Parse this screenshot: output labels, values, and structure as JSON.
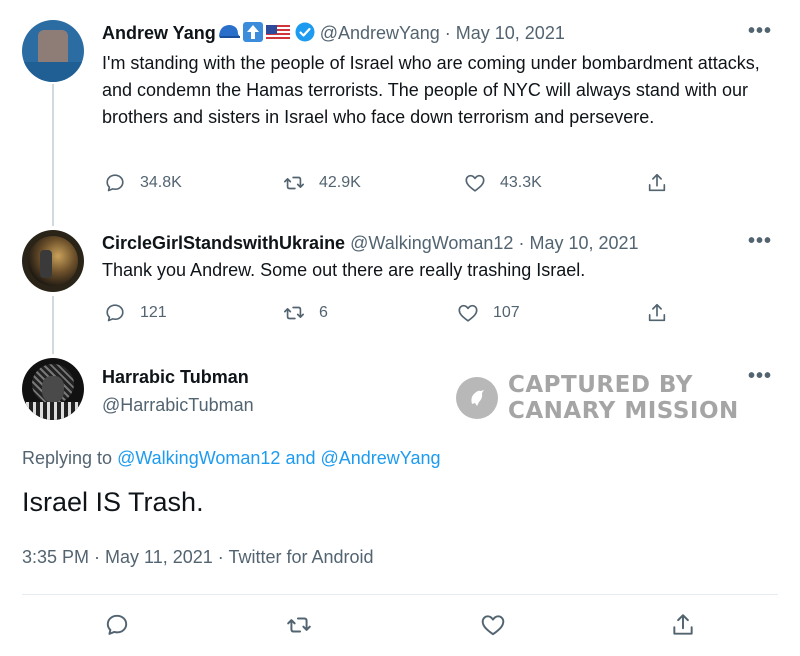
{
  "thread": {
    "tweets": [
      {
        "name": "Andrew Yang",
        "handle": "@AndrewYang",
        "separator": "·",
        "date": "May 10, 2021",
        "text": "I'm standing with the people of Israel who are coming under bombardment attacks, and condemn the Hamas terrorists. The people of NYC will always stand with our brothers and sisters in Israel who face down terrorism and persevere.",
        "more": "•••",
        "replies": "34.8K",
        "retweets": "42.9K",
        "likes": "43.3K"
      },
      {
        "name": "CircleGirlStandswithUkraine",
        "handle": "@WalkingWoman12",
        "separator": "·",
        "date": "May 10, 2021",
        "text": "Thank you Andrew. Some out there are really trashing Israel.",
        "more": "•••",
        "replies": "121",
        "retweets": "6",
        "likes": "107"
      }
    ]
  },
  "focused": {
    "name": "Harrabic Tubman",
    "handle": "@HarrabicTubman",
    "more": "•••",
    "replying_label": "Replying to",
    "reply_user1": "@WalkingWoman12",
    "and_label": "and",
    "reply_user2": "@AndrewYang",
    "text": "Israel IS Trash.",
    "meta": "3:35 PM · May 11, 2021 · Twitter for Android"
  },
  "watermark": {
    "line1": "CAPTURED BY",
    "line2": "CANARY MISSION"
  },
  "colors": {
    "link": "#1d9bf0",
    "muted": "#536471",
    "verified": "#1d9bf0"
  },
  "icons": [
    "reply-icon",
    "retweet-icon",
    "like-icon",
    "share-icon",
    "verified-icon",
    "cap-emoji-icon",
    "up-arrow-emoji-icon",
    "us-flag-emoji-icon",
    "canary-logo-icon"
  ]
}
